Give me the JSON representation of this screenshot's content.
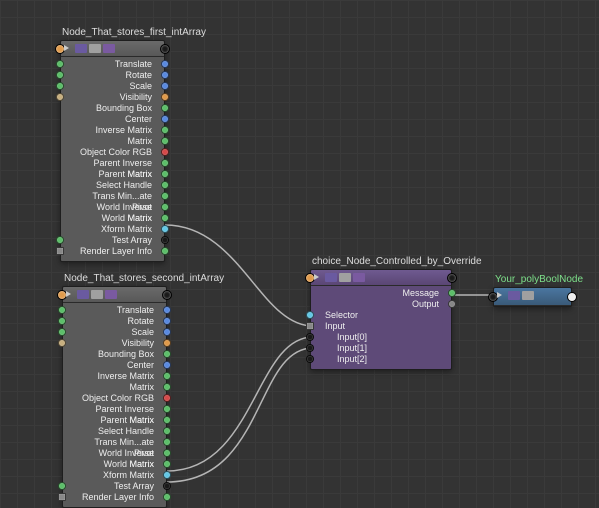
{
  "node1": {
    "title": "Node_That_stores_first_intArray",
    "attrs": [
      "Translate",
      "Rotate",
      "Scale",
      "Visibility",
      "Bounding Box",
      "Center",
      "Inverse Matrix",
      "Matrix",
      "Object Color RGB",
      "Parent Inverse Matrix",
      "Parent Matrix",
      "Select Handle",
      "Trans Min...ate Pivot",
      "World Inverse Matrix",
      "World Matrix",
      "Xform Matrix",
      "Test Array",
      "Render Layer Info"
    ]
  },
  "node2": {
    "title": "Node_That_stores_second_intArray",
    "attrs": [
      "Translate",
      "Rotate",
      "Scale",
      "Visibility",
      "Bounding Box",
      "Center",
      "Inverse Matrix",
      "Matrix",
      "Object Color RGB",
      "Parent Inverse Matrix",
      "Parent Matrix",
      "Select Handle",
      "Trans Min...ate Pivot",
      "World Inverse Matrix",
      "World Matrix",
      "Xform Matrix",
      "Test Array",
      "Render Layer Info"
    ]
  },
  "choice": {
    "title": "choice_Node_Controlled_by_Override",
    "outputs": [
      "Message",
      "Output"
    ],
    "inputs": [
      "Selector",
      "Input",
      "Input[0]",
      "Input[1]",
      "Input[2]"
    ]
  },
  "poly": {
    "title": "Your_polyBoolNode"
  },
  "colors": {
    "wire": "#b5b5b5"
  }
}
